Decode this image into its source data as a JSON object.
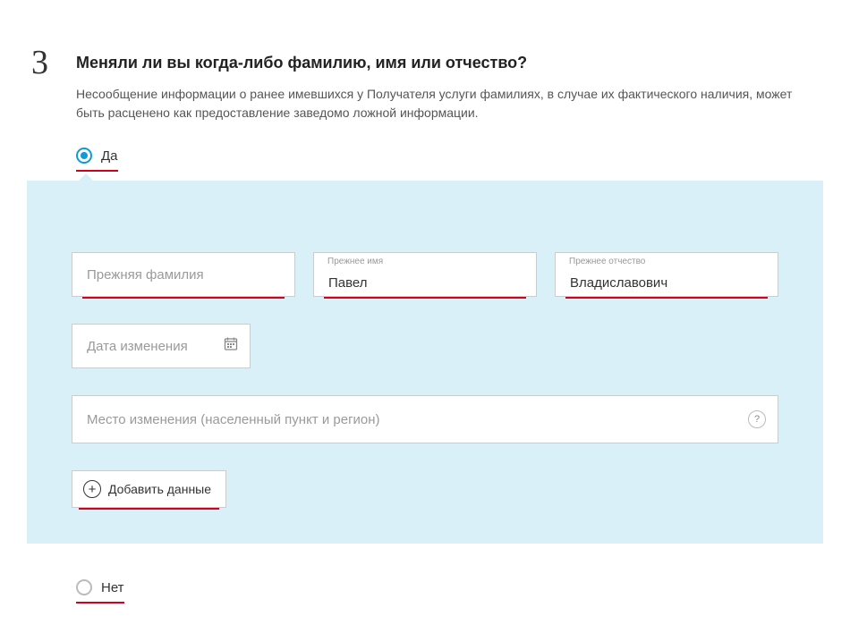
{
  "step": {
    "number": "3",
    "title": "Меняли ли вы когда-либо фамилию, имя или отчество?",
    "description": "Несообщение информации о ранее имевшихся у Получателя услуги фамилиях, в случае их фактического наличия, может быть расценено как предоставление заведомо ложной информации."
  },
  "radio": {
    "yes": "Да",
    "no": "Нет"
  },
  "fields": {
    "surname": {
      "placeholder": "Прежняя фамилия",
      "value": ""
    },
    "firstname": {
      "label": "Прежнее имя",
      "value": "Павел"
    },
    "patronymic": {
      "label": "Прежнее отчество",
      "value": "Владиславович"
    },
    "date": {
      "placeholder": "Дата изменения"
    },
    "place": {
      "placeholder": "Место изменения (населенный пункт и регион)"
    }
  },
  "addButton": "Добавить данные",
  "helpChar": "?"
}
